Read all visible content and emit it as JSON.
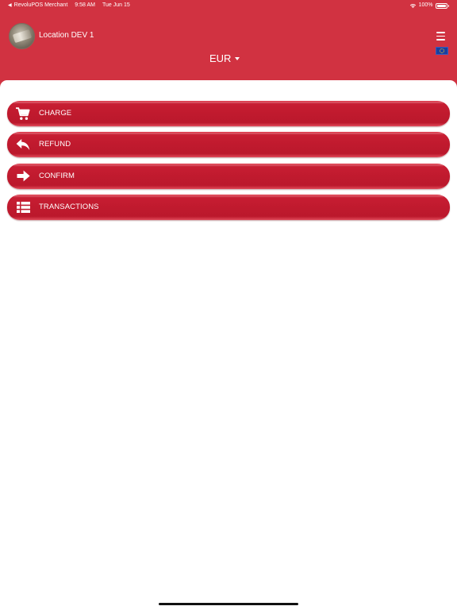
{
  "status_bar": {
    "back_app": "RevoluPOS Merchant",
    "time": "9:58 AM",
    "date": "Tue Jun 15",
    "battery": "100%",
    "battery_level": 1.0,
    "icons": {
      "back": "back-arrow-icon",
      "wifi": "wifi-icon",
      "battery": "battery-icon"
    }
  },
  "header": {
    "location": "Location DEV 1",
    "currency": "EUR",
    "menu_icon": "hamburger-menu-icon",
    "flag_icon": "eu-flag-icon",
    "avatar_icon": "location-avatar"
  },
  "actions": [
    {
      "label": "CHARGE",
      "icon": "shopping-cart-icon"
    },
    {
      "label": "REFUND",
      "icon": "reply-arrow-icon"
    },
    {
      "label": "CONFIRM",
      "icon": "arrow-right-icon"
    },
    {
      "label": "TRANSACTIONS",
      "icon": "list-icon"
    }
  ],
  "colors": {
    "header_bg": "#d13241",
    "button_bg": "#c01a2e",
    "text_on_primary": "#ffffff",
    "flag_blue": "#1b3f9e"
  }
}
